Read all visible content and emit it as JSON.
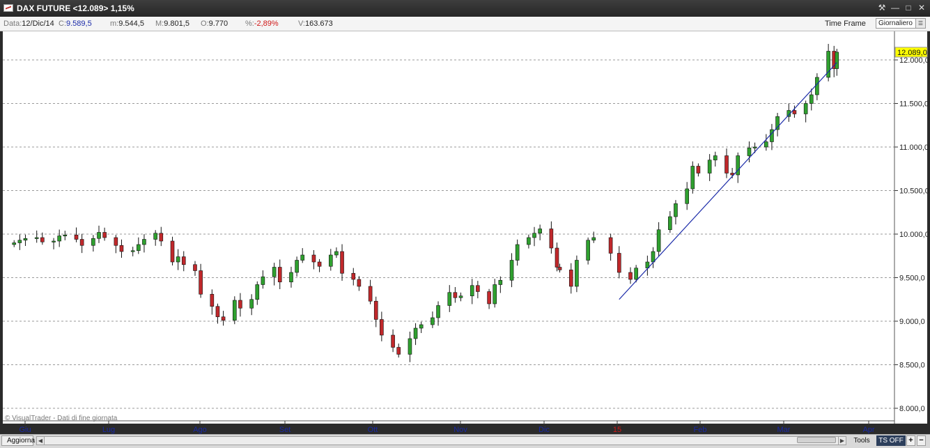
{
  "window": {
    "title": "DAX FUTURE <12.089> 1,15%",
    "buttons": {
      "tools": "⚒",
      "minimize": "—",
      "maximize": "□",
      "close": "✕"
    }
  },
  "infobar": {
    "data_label": "Data:",
    "data_value": "12/Dic/14",
    "c_label": "C:",
    "c_value": "9.589,5",
    "m_label": "m:",
    "m_value": "9.544,5",
    "M_label": "M:",
    "M_value": "9.801,5",
    "o_label": "O:",
    "o_value": "9.770",
    "pct_label": "%:",
    "pct_value": "-2,89%",
    "v_label": "V:",
    "v_value": "163.673",
    "timeframe_label": "Time Frame",
    "timeframe_value": "Giornaliero"
  },
  "chart_data": {
    "type": "candlestick",
    "instrument": "DAX FUTURE",
    "last_price_label": "12.089,0",
    "y_axis": {
      "min": 8000,
      "max": 12000,
      "tick_labels": [
        "12.000,0",
        "11.500,0",
        "11.000,0",
        "10.500,0",
        "10.000,0",
        "9.500,0",
        "9.000,0",
        "8.500,0",
        "8.000,0"
      ]
    },
    "x_axis": {
      "labels": [
        "Giu",
        "Lug",
        "Ago",
        "Set",
        "Ott",
        "Nov",
        "Dic",
        "15",
        "Feb",
        "Mar",
        "Apr"
      ]
    },
    "gridlines": "horizontal-dashed",
    "watermark": "© VisualTrader - Dati di fine giornata",
    "trendline": {
      "from": {
        "date": "2015-01-02",
        "price": 9250
      },
      "to": {
        "date": "2015-03-20",
        "price": 11970
      }
    },
    "series_close": [
      [
        "2014-06-02",
        9900
      ],
      [
        "2014-06-04",
        9930
      ],
      [
        "2014-06-06",
        9950
      ],
      [
        "2014-06-10",
        9960
      ],
      [
        "2014-06-12",
        9910
      ],
      [
        "2014-06-16",
        9920
      ],
      [
        "2014-06-18",
        9980
      ],
      [
        "2014-06-20",
        9990
      ],
      [
        "2014-06-24",
        9940
      ],
      [
        "2014-06-26",
        9870
      ],
      [
        "2014-06-30",
        9950
      ],
      [
        "2014-07-02",
        10020
      ],
      [
        "2014-07-04",
        9960
      ],
      [
        "2014-07-08",
        9870
      ],
      [
        "2014-07-10",
        9800
      ],
      [
        "2014-07-14",
        9810
      ],
      [
        "2014-07-16",
        9880
      ],
      [
        "2014-07-18",
        9940
      ],
      [
        "2014-07-22",
        10010
      ],
      [
        "2014-07-24",
        9920
      ],
      [
        "2014-07-28",
        9680
      ],
      [
        "2014-07-30",
        9740
      ],
      [
        "2014-08-01",
        9650
      ],
      [
        "2014-08-05",
        9580
      ],
      [
        "2014-08-07",
        9310
      ],
      [
        "2014-08-11",
        9170
      ],
      [
        "2014-08-13",
        9050
      ],
      [
        "2014-08-15",
        9010
      ],
      [
        "2014-08-19",
        9240
      ],
      [
        "2014-08-21",
        9150
      ],
      [
        "2014-08-25",
        9250
      ],
      [
        "2014-08-27",
        9420
      ],
      [
        "2014-08-29",
        9510
      ],
      [
        "2014-09-02",
        9620
      ],
      [
        "2014-09-04",
        9450
      ],
      [
        "2014-09-08",
        9560
      ],
      [
        "2014-09-10",
        9700
      ],
      [
        "2014-09-12",
        9760
      ],
      [
        "2014-09-16",
        9680
      ],
      [
        "2014-09-18",
        9630
      ],
      [
        "2014-09-22",
        9760
      ],
      [
        "2014-09-24",
        9800
      ],
      [
        "2014-09-26",
        9550
      ],
      [
        "2014-09-30",
        9480
      ],
      [
        "2014-10-02",
        9400
      ],
      [
        "2014-10-06",
        9230
      ],
      [
        "2014-10-08",
        9020
      ],
      [
        "2014-10-10",
        8840
      ],
      [
        "2014-10-14",
        8700
      ],
      [
        "2014-10-16",
        8620
      ],
      [
        "2014-10-20",
        8800
      ],
      [
        "2014-10-22",
        8920
      ],
      [
        "2014-10-24",
        8960
      ],
      [
        "2014-10-28",
        9040
      ],
      [
        "2014-10-30",
        9180
      ],
      [
        "2014-11-03",
        9330
      ],
      [
        "2014-11-05",
        9270
      ],
      [
        "2014-11-07",
        9290
      ],
      [
        "2014-11-11",
        9410
      ],
      [
        "2014-11-13",
        9340
      ],
      [
        "2014-11-17",
        9200
      ],
      [
        "2014-11-19",
        9420
      ],
      [
        "2014-11-21",
        9470
      ],
      [
        "2014-11-25",
        9700
      ],
      [
        "2014-11-27",
        9880
      ],
      [
        "2014-12-01",
        9960
      ],
      [
        "2014-12-03",
        10010
      ],
      [
        "2014-12-05",
        10060
      ],
      [
        "2014-12-09",
        9840
      ],
      [
        "2014-12-11",
        9620
      ],
      [
        "2014-12-12",
        9589
      ],
      [
        "2014-12-16",
        9400
      ],
      [
        "2014-12-18",
        9700
      ],
      [
        "2014-12-22",
        9930
      ],
      [
        "2014-12-24",
        9960
      ],
      [
        "2014-12-30",
        9780
      ],
      [
        "2015-01-02",
        9560
      ],
      [
        "2015-01-06",
        9480
      ],
      [
        "2015-01-08",
        9610
      ],
      [
        "2015-01-12",
        9680
      ],
      [
        "2015-01-14",
        9800
      ],
      [
        "2015-01-16",
        10050
      ],
      [
        "2015-01-20",
        10200
      ],
      [
        "2015-01-22",
        10350
      ],
      [
        "2015-01-26",
        10520
      ],
      [
        "2015-01-28",
        10780
      ],
      [
        "2015-01-30",
        10700
      ],
      [
        "2015-02-03",
        10850
      ],
      [
        "2015-02-05",
        10900
      ],
      [
        "2015-02-09",
        10700
      ],
      [
        "2015-02-11",
        10680
      ],
      [
        "2015-02-13",
        10900
      ],
      [
        "2015-02-17",
        10990
      ],
      [
        "2015-02-19",
        11000
      ],
      [
        "2015-02-23",
        11060
      ],
      [
        "2015-02-25",
        11200
      ],
      [
        "2015-02-27",
        11350
      ],
      [
        "2015-03-03",
        11420
      ],
      [
        "2015-03-05",
        11380
      ],
      [
        "2015-03-09",
        11500
      ],
      [
        "2015-03-11",
        11600
      ],
      [
        "2015-03-13",
        11800
      ],
      [
        "2015-03-17",
        12100
      ],
      [
        "2015-03-19",
        11900
      ],
      [
        "2015-03-20",
        12089
      ]
    ]
  },
  "bottombar": {
    "refresh_label": "Aggiorna",
    "tools_label": "Tools",
    "tsoff_label": "TS OFF",
    "plus_label": "+",
    "minus_label": "−"
  }
}
